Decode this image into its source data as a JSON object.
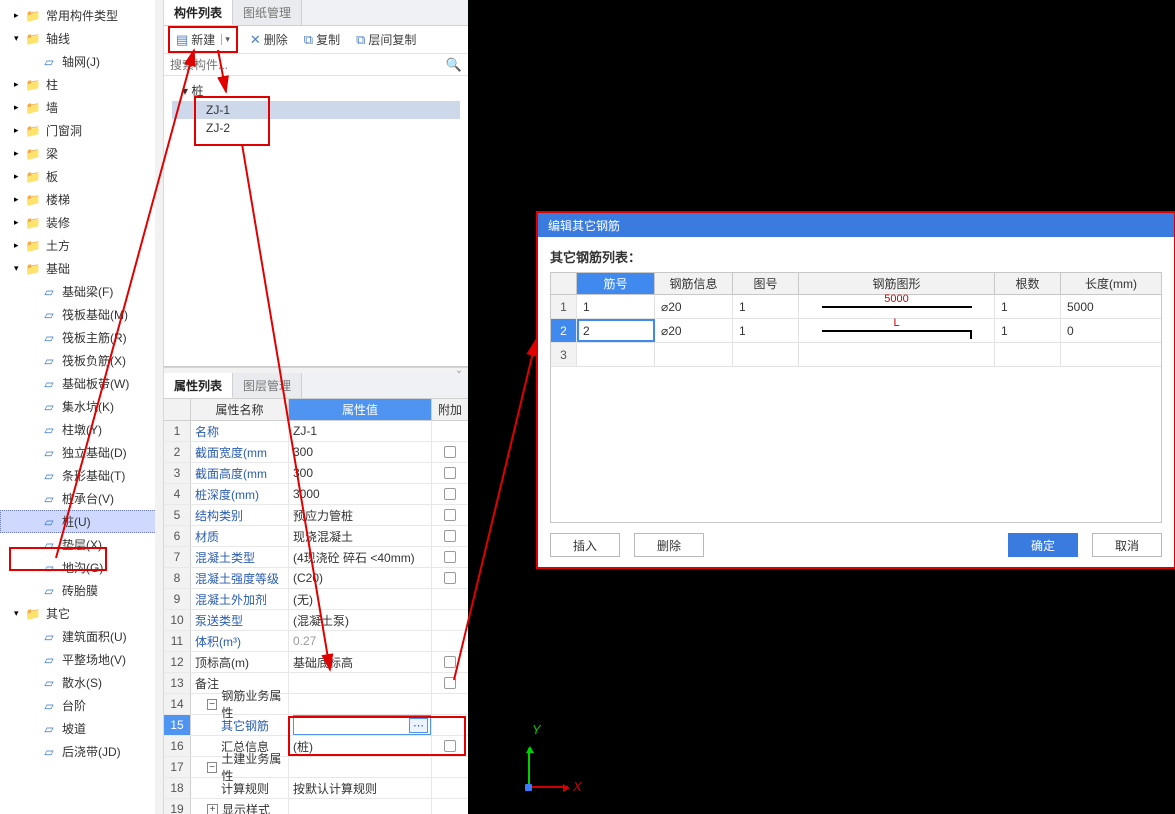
{
  "nav": {
    "groups": [
      {
        "label": "常用构件类型",
        "icon": "folder"
      },
      {
        "label": "轴线",
        "icon": "folder",
        "children": [
          {
            "label": "轴网(J)",
            "icon": "blue"
          }
        ]
      },
      {
        "label": "柱",
        "icon": "folder"
      },
      {
        "label": "墙",
        "icon": "folder"
      },
      {
        "label": "门窗洞",
        "icon": "folder"
      },
      {
        "label": "梁",
        "icon": "folder"
      },
      {
        "label": "板",
        "icon": "folder"
      },
      {
        "label": "楼梯",
        "icon": "folder"
      },
      {
        "label": "装修",
        "icon": "folder"
      },
      {
        "label": "土方",
        "icon": "folder"
      },
      {
        "label": "基础",
        "icon": "folder",
        "children": [
          {
            "label": "基础梁(F)",
            "icon": "blue"
          },
          {
            "label": "筏板基础(M)",
            "icon": "blue"
          },
          {
            "label": "筏板主筋(R)",
            "icon": "blue"
          },
          {
            "label": "筏板负筋(X)",
            "icon": "blue"
          },
          {
            "label": "基础板带(W)",
            "icon": "blue"
          },
          {
            "label": "集水坑(K)",
            "icon": "blue"
          },
          {
            "label": "柱墩(Y)",
            "icon": "blue"
          },
          {
            "label": "独立基础(D)",
            "icon": "blue"
          },
          {
            "label": "条形基础(T)",
            "icon": "blue"
          },
          {
            "label": "桩承台(V)",
            "icon": "blue"
          },
          {
            "label": "桩(U)",
            "icon": "blue",
            "selected": true
          },
          {
            "label": "垫层(X)",
            "icon": "blue"
          },
          {
            "label": "地沟(G)",
            "icon": "blue"
          },
          {
            "label": "砖胎膜",
            "icon": "blue"
          }
        ]
      },
      {
        "label": "其它",
        "icon": "folder",
        "children": [
          {
            "label": "建筑面积(U)",
            "icon": "blue"
          },
          {
            "label": "平整场地(V)",
            "icon": "blue"
          },
          {
            "label": "散水(S)",
            "icon": "blue"
          },
          {
            "label": "台阶",
            "icon": "blue"
          },
          {
            "label": "坡道",
            "icon": "blue"
          },
          {
            "label": "后浇带(JD)",
            "icon": "blue"
          }
        ]
      }
    ]
  },
  "comp_tabs": {
    "a": "构件列表",
    "b": "图纸管理"
  },
  "toolbar": {
    "new": "新建",
    "del": "删除",
    "copy": "复制",
    "layercopy": "层间复制"
  },
  "search_placeholder": "搜索构件...",
  "tree": {
    "root": "桩",
    "items": [
      "ZJ-1",
      "ZJ-2"
    ],
    "selected": 0
  },
  "prop_tabs": {
    "a": "属性列表",
    "b": "图层管理"
  },
  "prop_head": {
    "name": "属性名称",
    "val": "属性值",
    "ext": "附加"
  },
  "props": [
    {
      "n": "1",
      "name": "名称",
      "val": "ZJ-1",
      "link": true
    },
    {
      "n": "2",
      "name": "截面宽度(mm",
      "val": "300",
      "link": true,
      "chk": true
    },
    {
      "n": "3",
      "name": "截面高度(mm",
      "val": "300",
      "link": true,
      "chk": true
    },
    {
      "n": "4",
      "name": "桩深度(mm)",
      "val": "3000",
      "link": true,
      "chk": true
    },
    {
      "n": "5",
      "name": "结构类别",
      "val": "预应力管桩",
      "link": true,
      "chk": true
    },
    {
      "n": "6",
      "name": "材质",
      "val": "现浇混凝土",
      "link": true,
      "chk": true
    },
    {
      "n": "7",
      "name": "混凝土类型",
      "val": "(4现浇砼 碎石 <40mm)",
      "link": true,
      "chk": true
    },
    {
      "n": "8",
      "name": "混凝土强度等级",
      "val": "(C20)",
      "link": true,
      "chk": true
    },
    {
      "n": "9",
      "name": "混凝土外加剂",
      "val": "(无)",
      "link": true
    },
    {
      "n": "10",
      "name": "泵送类型",
      "val": "(混凝土泵)",
      "link": true
    },
    {
      "n": "11",
      "name": "体积(m³)",
      "val": "0.27",
      "link": true,
      "gray": true
    },
    {
      "n": "12",
      "name": "顶标高(m)",
      "val": "基础底标高",
      "chk": true
    },
    {
      "n": "13",
      "name": "备注",
      "val": "",
      "chk": true
    },
    {
      "n": "14",
      "name": "钢筋业务属性",
      "grp": true,
      "open": true
    },
    {
      "n": "15",
      "name": "其它钢筋",
      "val": "",
      "indent": 2,
      "link": true,
      "edit": true
    },
    {
      "n": "16",
      "name": "汇总信息",
      "val": "(桩)",
      "indent": 2,
      "chk": true
    },
    {
      "n": "17",
      "name": "土建业务属性",
      "grp": true,
      "open": true
    },
    {
      "n": "18",
      "name": "计算规则",
      "val": "按默认计算规则",
      "indent": 2
    },
    {
      "n": "19",
      "name": "显示样式",
      "grp": true,
      "open": false
    }
  ],
  "dialog": {
    "title": "编辑其它钢筋",
    "subtitle": "其它钢筋列表：",
    "headers": {
      "c1": "筋号",
      "c2": "钢筋信息",
      "c3": "图号",
      "c4": "钢筋图形",
      "c5": "根数",
      "c6": "长度(mm)"
    },
    "rows": [
      {
        "num": "1",
        "c1": "1",
        "c2": "⌀20",
        "c3": "1",
        "shape_label": "5000",
        "shape": "line",
        "c5": "1",
        "c6": "5000"
      },
      {
        "num": "2",
        "c1": "2",
        "c2": "⌀20",
        "c3": "1",
        "shape_label": "L",
        "shape": "L",
        "c5": "1",
        "c6": "0",
        "sel": true
      },
      {
        "num": "3",
        "c1": "",
        "c2": "",
        "c3": "",
        "shape_label": "",
        "shape": "",
        "c5": "",
        "c6": ""
      }
    ],
    "btn_insert": "插入",
    "btn_del": "删除",
    "btn_ok": "确定",
    "btn_cancel": "取消"
  },
  "axis": {
    "x": "X",
    "y": "Y"
  }
}
